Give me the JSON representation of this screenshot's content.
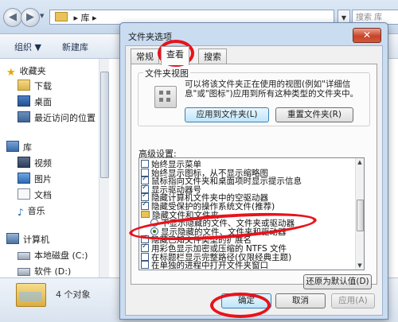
{
  "explorer": {
    "breadcrumb": [
      "库"
    ],
    "search_placeholder": "搜索 库",
    "toolbar": {
      "organize": "组织 ▼",
      "new_library": "新建库"
    },
    "nav": {
      "favorites": "收藏夹",
      "downloads": "下载",
      "desktop": "桌面",
      "recent": "最近访问的位置",
      "libraries": "库",
      "videos": "视频",
      "pictures": "图片",
      "documents": "文档",
      "music": "音乐",
      "computer": "计算机",
      "local_disk": "本地磁盘 (C:)",
      "software": "软件 (D:)"
    },
    "status": {
      "count": "4 个对象"
    }
  },
  "dialog": {
    "title": "文件夹选项",
    "close_glyph": "✕",
    "tabs": [
      {
        "label": "常规"
      },
      {
        "label": "查看"
      },
      {
        "label": "搜索"
      }
    ],
    "folder_views": {
      "title": "文件夹视图",
      "description": "可以将该文件夹正在使用的视图(例如\"详细信息\"或\"图标\")应用到所有这种类型的文件夹中。",
      "apply_button": "应用到文件夹(L)",
      "reset_button": "重置文件夹(R)"
    },
    "advanced": {
      "label": "高级设置:",
      "items": [
        {
          "text": "始终显示菜单",
          "kind": "checkbox",
          "checked": false
        },
        {
          "text": "始终显示图标，从不显示缩略图",
          "kind": "checkbox",
          "checked": false
        },
        {
          "text": "鼠标指向文件夹和桌面项时显示提示信息",
          "kind": "checkbox",
          "checked": true
        },
        {
          "text": "显示驱动器号",
          "kind": "checkbox",
          "checked": true
        },
        {
          "text": "隐藏计算机文件夹中的空驱动器",
          "kind": "checkbox",
          "checked": true
        },
        {
          "text": "隐藏受保护的操作系统文件(推荐)",
          "kind": "checkbox",
          "checked": true
        },
        {
          "text": "隐藏文件和文件夹",
          "kind": "folder",
          "checked": false
        },
        {
          "text": "不显示隐藏的文件、文件夹或驱动器",
          "kind": "radio",
          "checked": false
        },
        {
          "text": "显示隐藏的文件、文件夹和驱动器",
          "kind": "radio",
          "checked": true
        },
        {
          "text": "隐藏已知文件类型的扩展名",
          "kind": "checkbox",
          "checked": true
        },
        {
          "text": "用彩色显示加密或压缩的 NTFS 文件",
          "kind": "checkbox",
          "checked": true
        },
        {
          "text": "在标题栏显示完整路径(仅限经典主题)",
          "kind": "checkbox",
          "checked": false
        },
        {
          "text": "在单独的进程中打开文件夹窗口",
          "kind": "checkbox",
          "checked": false
        }
      ],
      "restore_button": "还原为默认值(D)"
    },
    "buttons": {
      "ok": "确定",
      "cancel": "取消",
      "apply": "应用(A)"
    }
  },
  "annotations": {
    "color": "#e8121b"
  }
}
